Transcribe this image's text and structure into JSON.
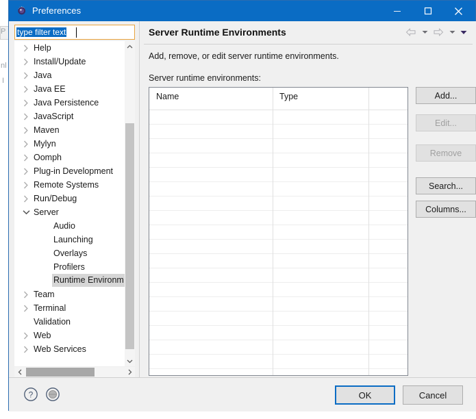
{
  "window": {
    "title": "Preferences",
    "icon": "gear-icon",
    "controls": {
      "minimize": "minimize-icon",
      "maximize": "maximize-icon",
      "close": "close-icon"
    },
    "titlebar_color": "#0a6cc4"
  },
  "filter": {
    "value": "type filter text",
    "placeholder": "type filter text",
    "selected": true
  },
  "tree": {
    "items": [
      {
        "label": "Help",
        "level": 0,
        "expandable": true,
        "expanded": false,
        "selected": false
      },
      {
        "label": "Install/Update",
        "level": 0,
        "expandable": true,
        "expanded": false,
        "selected": false
      },
      {
        "label": "Java",
        "level": 0,
        "expandable": true,
        "expanded": false,
        "selected": false
      },
      {
        "label": "Java EE",
        "level": 0,
        "expandable": true,
        "expanded": false,
        "selected": false
      },
      {
        "label": "Java Persistence",
        "level": 0,
        "expandable": true,
        "expanded": false,
        "selected": false
      },
      {
        "label": "JavaScript",
        "level": 0,
        "expandable": true,
        "expanded": false,
        "selected": false
      },
      {
        "label": "Maven",
        "level": 0,
        "expandable": true,
        "expanded": false,
        "selected": false
      },
      {
        "label": "Mylyn",
        "level": 0,
        "expandable": true,
        "expanded": false,
        "selected": false
      },
      {
        "label": "Oomph",
        "level": 0,
        "expandable": true,
        "expanded": false,
        "selected": false
      },
      {
        "label": "Plug-in Development",
        "level": 0,
        "expandable": true,
        "expanded": false,
        "selected": false
      },
      {
        "label": "Remote Systems",
        "level": 0,
        "expandable": true,
        "expanded": false,
        "selected": false
      },
      {
        "label": "Run/Debug",
        "level": 0,
        "expandable": true,
        "expanded": false,
        "selected": false
      },
      {
        "label": "Server",
        "level": 0,
        "expandable": true,
        "expanded": true,
        "selected": false
      },
      {
        "label": "Audio",
        "level": 1,
        "expandable": false,
        "expanded": false,
        "selected": false
      },
      {
        "label": "Launching",
        "level": 1,
        "expandable": false,
        "expanded": false,
        "selected": false
      },
      {
        "label": "Overlays",
        "level": 1,
        "expandable": false,
        "expanded": false,
        "selected": false
      },
      {
        "label": "Profilers",
        "level": 1,
        "expandable": false,
        "expanded": false,
        "selected": false
      },
      {
        "label": "Runtime Environm",
        "level": 1,
        "expandable": false,
        "expanded": false,
        "selected": true
      },
      {
        "label": "Team",
        "level": 0,
        "expandable": true,
        "expanded": false,
        "selected": false
      },
      {
        "label": "Terminal",
        "level": 0,
        "expandable": true,
        "expanded": false,
        "selected": false
      },
      {
        "label": "Validation",
        "level": 0,
        "expandable": false,
        "expanded": false,
        "selected": false
      },
      {
        "label": "Web",
        "level": 0,
        "expandable": true,
        "expanded": false,
        "selected": false
      },
      {
        "label": "Web Services",
        "level": 0,
        "expandable": true,
        "expanded": false,
        "selected": false
      }
    ],
    "scroll": {
      "vertical_up": "chevron-up-icon",
      "vertical_down": "chevron-down-icon",
      "horizontal_left": "chevron-left-icon",
      "horizontal_right": "chevron-right-icon"
    }
  },
  "page": {
    "title": "Server Runtime Environments",
    "description": "Add, remove, or edit server runtime environments.",
    "table_label": "Server runtime environments:",
    "nav": {
      "back": "back-arrow-icon",
      "back_menu": "caret-down-icon",
      "forward": "forward-arrow-icon",
      "forward_menu": "caret-down-icon",
      "view_menu": "caret-down-filled-icon"
    }
  },
  "table": {
    "columns": [
      "Name",
      "Type",
      ""
    ],
    "rows": [],
    "empty_row_count": 18
  },
  "side_buttons": [
    {
      "label": "Add...",
      "enabled": true,
      "name": "add-button"
    },
    {
      "label": "Edit...",
      "enabled": false,
      "name": "edit-button"
    },
    {
      "label": "Remove",
      "enabled": false,
      "name": "remove-button"
    },
    {
      "label": "Search...",
      "enabled": true,
      "name": "search-button"
    },
    {
      "label": "Columns...",
      "enabled": true,
      "name": "columns-button"
    }
  ],
  "footer": {
    "help_icon": "question-mark-icon",
    "apply_icon": "circle-icon",
    "ok_label": "OK",
    "cancel_label": "Cancel",
    "default_button": "OK"
  },
  "colors": {
    "accent": "#0a6cc4",
    "selection": "#0a6cc4",
    "tree_selection": "#d6d6d6",
    "dialog_bg": "#f0f0f0",
    "button_bg": "#e1e1e1",
    "disabled_text": "#a0a0a0"
  }
}
